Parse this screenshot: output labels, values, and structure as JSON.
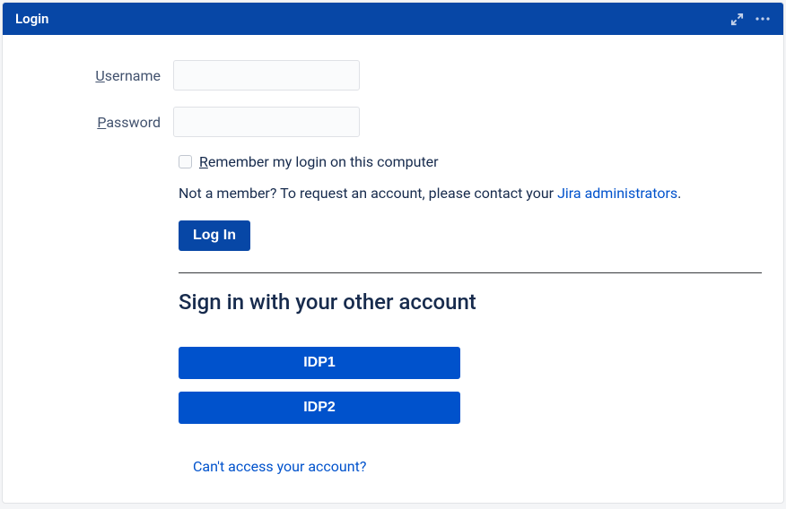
{
  "header": {
    "title": "Login"
  },
  "form": {
    "username_label_pre": "U",
    "username_label_post": "sername",
    "password_label_pre": "P",
    "password_label_post": "assword",
    "remember_pre": "R",
    "remember_post": "emember my login on this computer",
    "not_member_pre": "Not a member? To request an account, please contact your ",
    "admin_link": "Jira administrators",
    "not_member_post": ".",
    "login_button": "Log In"
  },
  "sso": {
    "heading": "Sign in with your other account",
    "idp1": "IDP1",
    "idp2": "IDP2"
  },
  "footer": {
    "cant_access": "Can't access your account?"
  }
}
